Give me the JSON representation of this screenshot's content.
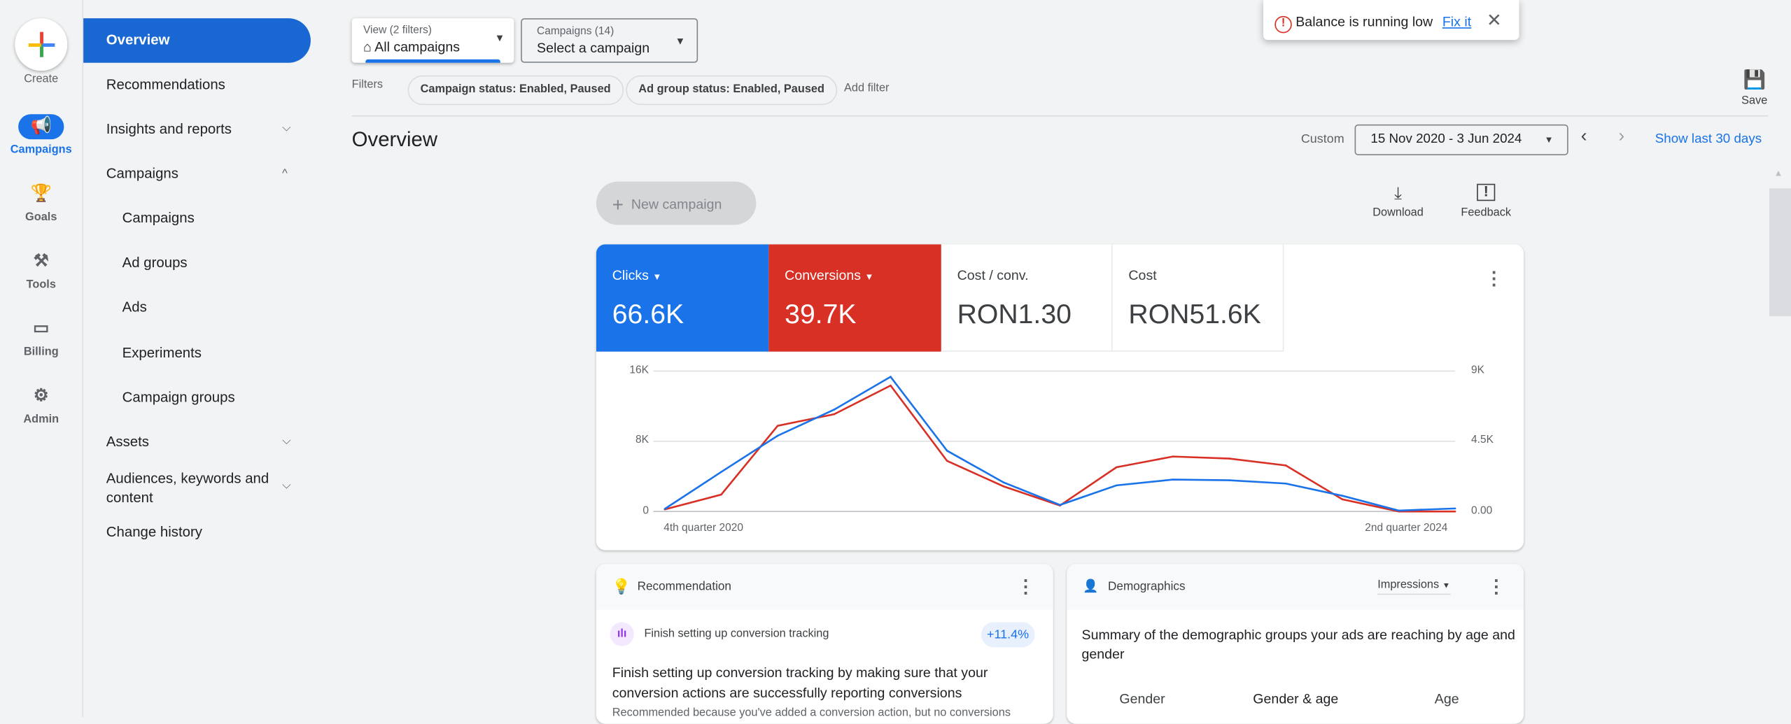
{
  "rail": {
    "create": "Create",
    "items": [
      {
        "label": "Campaigns"
      },
      {
        "label": "Goals"
      },
      {
        "label": "Tools"
      },
      {
        "label": "Billing"
      },
      {
        "label": "Admin"
      }
    ]
  },
  "nav": {
    "overview": "Overview",
    "recommendations": "Recommendations",
    "insights": "Insights and reports",
    "campaigns": "Campaigns",
    "sub": [
      "Campaigns",
      "Ad groups",
      "Ads",
      "Experiments",
      "Campaign groups"
    ],
    "assets": "Assets",
    "audiences": "Audiences, keywords and content",
    "change_history": "Change history"
  },
  "view": {
    "label": "View (2 filters)",
    "value": "All campaigns"
  },
  "campaign_select": {
    "label": "Campaigns (14)",
    "value": "Select a campaign"
  },
  "filters": {
    "label": "Filters",
    "chips": [
      "Campaign status: Enabled, Paused",
      "Ad group status: Enabled, Paused"
    ],
    "add": "Add filter"
  },
  "alert": {
    "text": "Balance is running low",
    "link": "Fix it"
  },
  "save": "Save",
  "page_title": "Overview",
  "date": {
    "label": "Custom",
    "range": "15 Nov 2020 - 3 Jun 2024",
    "last30": "Show last 30 days"
  },
  "actions": {
    "new_campaign": "New campaign",
    "download": "Download",
    "feedback": "Feedback"
  },
  "metrics": [
    {
      "label": "Clicks",
      "value": "66.6K"
    },
    {
      "label": "Conversions",
      "value": "39.7K"
    },
    {
      "label": "Cost / conv.",
      "value": "RON1.30"
    },
    {
      "label": "Cost",
      "value": "RON51.6K"
    }
  ],
  "colors": {
    "clicks": "#1a73e8",
    "conversions": "#d93025"
  },
  "chart_data": {
    "type": "line",
    "x": [
      0,
      1,
      2,
      3,
      4,
      5,
      6,
      7,
      8,
      9,
      10,
      11,
      12,
      13,
      14
    ],
    "x_labels": [
      "4th quarter 2020",
      "2nd quarter 2024"
    ],
    "series": [
      {
        "name": "Clicks",
        "axis": "left",
        "values": [
          290,
          4500,
          8630,
          11600,
          15340,
          6920,
          3310,
          740,
          2970,
          3630,
          3550,
          3180,
          1790,
          100,
          340
        ]
      },
      {
        "name": "Conversions",
        "axis": "right",
        "values": [
          130,
          1080,
          5490,
          6230,
          8070,
          3240,
          1610,
          380,
          2830,
          3520,
          3390,
          2950,
          780,
          0,
          0
        ]
      }
    ],
    "left_ticks": [
      "16K",
      "8K",
      "0"
    ],
    "right_ticks": [
      "9K",
      "4.5K",
      "0.00"
    ],
    "ylim_left": [
      0,
      16000
    ],
    "ylim_right": [
      0,
      9000
    ]
  },
  "recommendation": {
    "title": "Recommendation",
    "item": "Finish setting up conversion tracking",
    "uplift": "+11.4%",
    "body": "Finish setting up conversion tracking by making sure that your conversion actions are successfully reporting conversions",
    "reason": "Recommended because you've added a conversion action, but no conversions"
  },
  "demographics": {
    "title": "Demographics",
    "metric": "Impressions",
    "summary": "Summary of the demographic groups your ads are reaching by age and gender",
    "tabs": [
      "Gender",
      "Gender & age",
      "Age"
    ]
  }
}
